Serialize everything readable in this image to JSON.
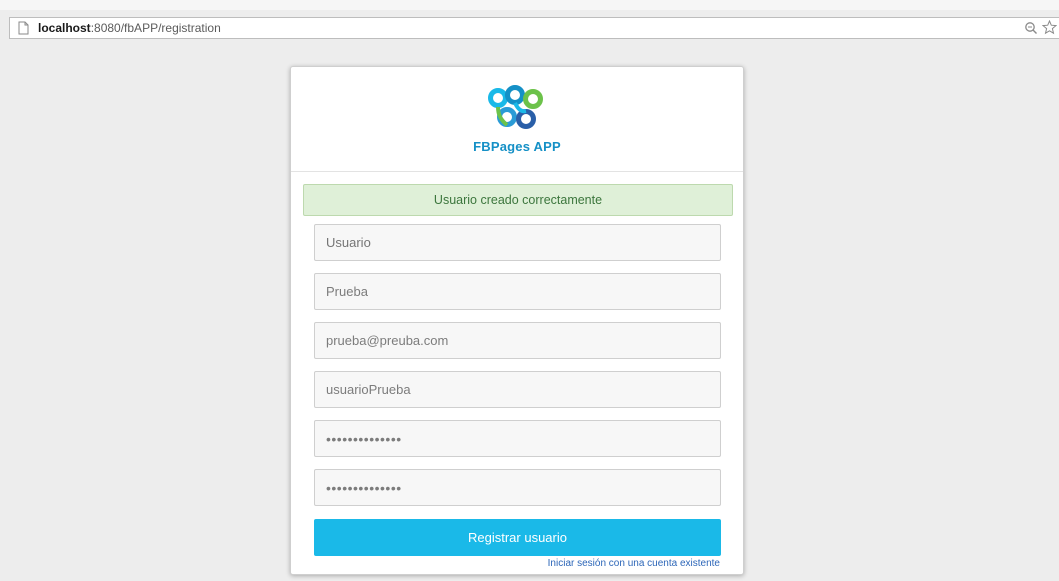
{
  "browser": {
    "url_host": "localhost",
    "url_rest": ":8080/fbAPP/registration"
  },
  "logo": {
    "text": "FBPages APP",
    "colors": [
      "#1ab9e8",
      "#1590c6",
      "#6cc24a",
      "#2a5fa8"
    ]
  },
  "alert": {
    "message": "Usuario creado correctamente"
  },
  "form": {
    "fields": [
      {
        "name": "usuario",
        "placeholder": "Usuario",
        "value": ""
      },
      {
        "name": "apellido",
        "placeholder": "",
        "value": "Prueba"
      },
      {
        "name": "email",
        "placeholder": "",
        "value": "prueba@preuba.com"
      },
      {
        "name": "username",
        "placeholder": "",
        "value": "usuarioPrueba"
      },
      {
        "name": "password",
        "placeholder": "",
        "value": "••••••••••••••"
      },
      {
        "name": "password-confirm",
        "placeholder": "",
        "value": "••••••••••••••"
      }
    ],
    "submit_label": "Registrar usuario",
    "login_link": "Iniciar sesión con una cuenta existente"
  },
  "colors": {
    "accent": "#1ab9e8",
    "success_bg": "#dff0d8",
    "success_text": "#3c763d",
    "link": "#2c66b8"
  }
}
